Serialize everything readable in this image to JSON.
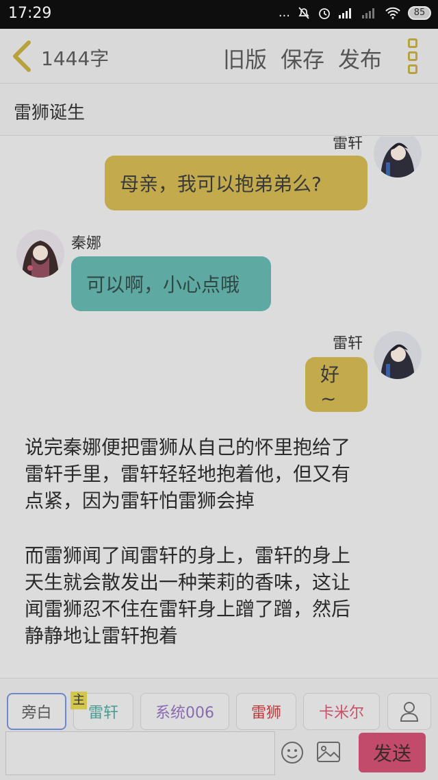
{
  "status_bar": {
    "time": "17:29",
    "battery": "85",
    "signal_dots": "..."
  },
  "header": {
    "word_count": "1444字",
    "old_version": "旧版",
    "save": "保存",
    "publish": "发布"
  },
  "chapter_title": "雷狮诞生",
  "messages": [
    {
      "sender": "雷轩",
      "text": "母亲，我可以抱弟弟么?",
      "side": "right",
      "color": "#c3ab4d"
    },
    {
      "sender": "秦娜",
      "text": "可以啊，小心点哦",
      "side": "left",
      "color": "#5eaaa2"
    },
    {
      "sender": "雷轩",
      "text": "好~",
      "side": "right",
      "color": "#c3ab4d"
    }
  ],
  "narration": [
    [
      "说完秦娜便把雷狮从自己的怀里抱给了",
      "雷轩手里，雷轩轻轻地抱着他，但又有",
      "点紧，因为雷轩怕雷狮会掉"
    ],
    [
      "而雷狮闻了闻雷轩的身上，雷轩的身上",
      "天生就会散发出一种茉莉的香味，这让",
      "闻雷狮忍不住在雷轩身上蹭了蹭，然后",
      "静静地让雷轩抱着"
    ]
  ],
  "roles": [
    {
      "label": "旁白",
      "color": "#555555"
    },
    {
      "label": "雷轩",
      "color": "#4a9c92",
      "badge": "主"
    },
    {
      "label": "系统006",
      "color": "#8a6ab0"
    },
    {
      "label": "雷狮",
      "color": "#c0393b"
    },
    {
      "label": "卡米尔",
      "color": "#c8506a"
    }
  ],
  "input": {
    "placeholder": "",
    "send": "发送"
  },
  "icons": [
    "back-chevron-icon",
    "more-icon",
    "person-icon",
    "emoji-icon",
    "image-icon"
  ]
}
